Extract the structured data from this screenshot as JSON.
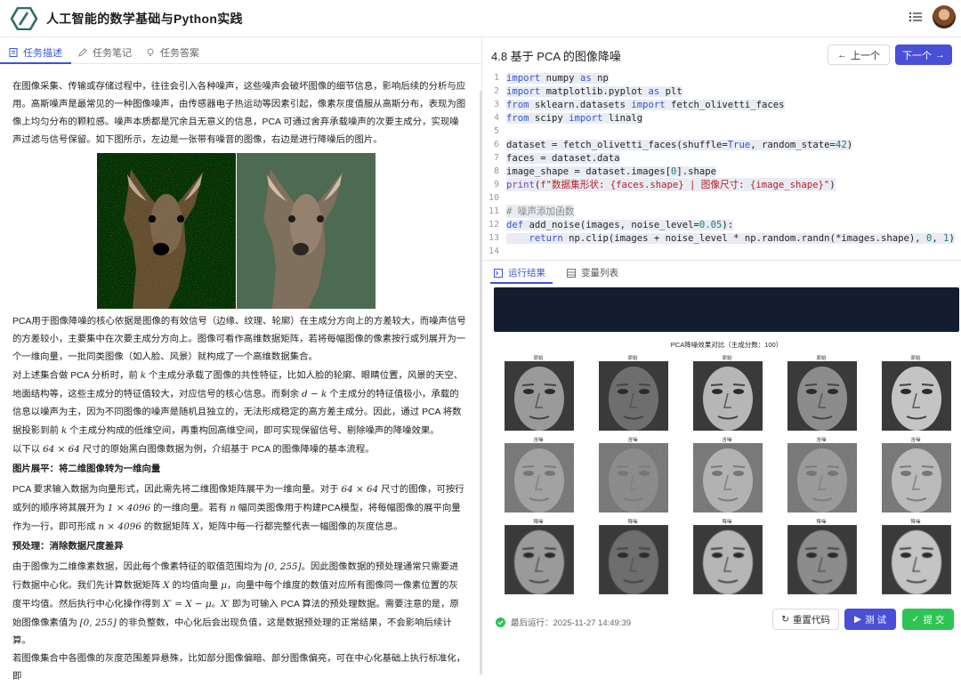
{
  "header": {
    "app_title": "人工智能的数学基础与Python实践",
    "menu_icon": "list-icon",
    "avatar_icon": "user-avatar"
  },
  "left_tabs": [
    {
      "label": "任务描述",
      "icon": "document-icon",
      "active": true
    },
    {
      "label": "任务笔记",
      "icon": "pencil-icon",
      "active": false
    },
    {
      "label": "任务答案",
      "icon": "lightbulb-icon",
      "active": false
    }
  ],
  "doc": {
    "p1": "在图像采集、传输或存储过程中，往往会引入各种噪声，这些噪声会破坏图像的细节信息，影响后续的分析与应用。高斯噪声是最常见的一种图像噪声，由传感器电子热运动等因素引起，像素灰度值服从高斯分布，表现为图像上均匀分布的颗粒感。噪声本质都是冗余且无意义的信息，PCA 可通过舍弃承载噪声的次要主成分，实现噪声过滤与信号保留。如下图所示，左边是一张带有噪音的图像，右边是进行降噪后的图片。",
    "p2": "PCA用于图像降噪的核心依据是图像的有效信号（边缘、纹理、轮廓）在主成分方向上的方差较大，而噪声信号的方差较小，主要集中在次要主成分方向上。图像可看作高维数据矩阵，若将每幅图像的像素按行或列展开为一个一维向量，一批同类图像（如人脸、风景）就构成了一个高维数据集合。",
    "p3_a": "对上述集合做 PCA 分析时，前",
    "p3_k1": "k",
    "p3_b": "个主成分承载了图像的共性特征，比如人脸的轮廓、眼睛位置，风景的天空、地面结构等，这些主成分的特征值较大，对应信号的核心信息。而剩余",
    "p3_dk": "d − k",
    "p3_c": "个主成分的特征值极小，承载的信息以噪声为主，因为不同图像的噪声是随机且独立的，无法形成稳定的高方差主成分。因此，通过 PCA 将数据投影到前",
    "p3_k2": "k",
    "p3_d": "个主成分构成的低维空间，再重构回高维空间，即可实现保留信号、剔除噪声的降噪效果。",
    "p4_a": "以下以",
    "p4_m": "64 × 64",
    "p4_b": "尺寸的原始黑白图像数据为例，介绍基于 PCA 的图像降噪的基本流程。",
    "h1": "图片展平：将二维图像转为一维向量",
    "p5_a": "PCA 要求输入数据为向量形式，因此需先将二维图像矩阵展平为一维向量。对于",
    "p5_m1": "64 × 64",
    "p5_b": "尺寸的图像，可按行或列的顺序将其展开为",
    "p5_m2": "1 × 4096",
    "p5_c": "的一维向量。若有",
    "p5_n": "n",
    "p5_d": "幅同类图像用于构建PCA模型，将每幅图像的展平向量作为一行，即可形成",
    "p5_m3": "n × 4096",
    "p5_e": "的数据矩阵",
    "p5_X": "X",
    "p5_f": "，矩阵中每一行都完整代表一幅图像的灰度信息。",
    "h2": "预处理：消除数据尺度差异",
    "p6_a": "由于图像为二维像素数据，因此每个像素特征的取值范围均为",
    "p6_m1": "[0, 255]",
    "p6_b": "。因此图像数据的预处理通常只需要进行数据中心化。我们先计算数据矩阵",
    "p6_X": "X",
    "p6_c": "的均值向量",
    "p6_mu": "μ",
    "p6_d": "，向量中每个维度的数值对应所有图像同一像素位置的灰度平均值。然后执行中心化操作得到",
    "p6_eq": "X′ = X − μ",
    "p6_e": "。",
    "p6_X2": "X′",
    "p6_f": "即为可输入 PCA 算法的预处理数据。需要注意的是，原始图像像素值为",
    "p6_m2": "[0, 255]",
    "p6_g": "的非负整数，中心化后会出现负值，这是数据预处理的正常结果，不会影响后续计算。",
    "p7": "若图像集合中各图像的灰度范围差异悬殊，比如部分图像偏暗、部分图像偏亮，可在中心化基础上执行标准化，即"
  },
  "task": {
    "title": "4.8 基于 PCA 的图像降噪",
    "prev_label": "上一个",
    "next_label": "下一个"
  },
  "code_lines": [
    {
      "n": "1",
      "html": "<span class=\"kw\">import</span> numpy <span class=\"kw\">as</span> np"
    },
    {
      "n": "2",
      "html": "<span class=\"kw\">import</span> matplotlib.pyplot <span class=\"kw\">as</span> plt"
    },
    {
      "n": "3",
      "html": "<span class=\"kw\">from</span> sklearn.datasets <span class=\"kw\">import</span> fetch_olivetti_faces"
    },
    {
      "n": "4",
      "html": "<span class=\"kw\">from</span> scipy <span class=\"kw\">import</span> linalg"
    },
    {
      "n": "5",
      "html": ""
    },
    {
      "n": "6",
      "html": "dataset = fetch_olivetti_faces(shuffle=<span class=\"kw\">True</span>, random_state=<span class=\"num\">42</span>)"
    },
    {
      "n": "7",
      "html": "faces = dataset.data"
    },
    {
      "n": "8",
      "html": "image_shape = dataset.images[<span class=\"num\">0</span>].shape"
    },
    {
      "n": "9",
      "html": "<span class=\"fn\">print</span>(<span class=\"str\">f\"数据集形状: {faces.shape} | 图像尺寸: {image_shape}\"</span>)"
    },
    {
      "n": "10",
      "html": ""
    },
    {
      "n": "11",
      "html": "<span class=\"cmt\"># 噪声添加函数</span>"
    },
    {
      "n": "12",
      "html": "<span class=\"kw\">def</span> add_noise(images, noise_level=<span class=\"num\">0.05</span>):"
    },
    {
      "n": "13",
      "html": "    <span class=\"kw\">return</span> np.clip(images + noise_level * np.random.randn(*images.shape), <span class=\"num\">0</span>, <span class=\"num\">1</span>)"
    },
    {
      "n": "14",
      "html": ""
    }
  ],
  "result_tabs": [
    {
      "label": "运行结果",
      "icon": "terminal-icon",
      "active": true
    },
    {
      "label": "变量列表",
      "icon": "table-icon",
      "active": false
    }
  ],
  "figure": {
    "title": "PCA降噪效果对比（主成分数：100）",
    "row_labels": [
      "原始",
      "含噪",
      "降噪"
    ]
  },
  "footer": {
    "status": "最后运行：2025-11-27 14:49:39",
    "reset_label": "重置代码",
    "test_label": "测 试",
    "submit_label": "提 交"
  },
  "colors": {
    "accent": "#4a4fd8",
    "success": "#2ec453",
    "console_bg": "#141c2f"
  }
}
